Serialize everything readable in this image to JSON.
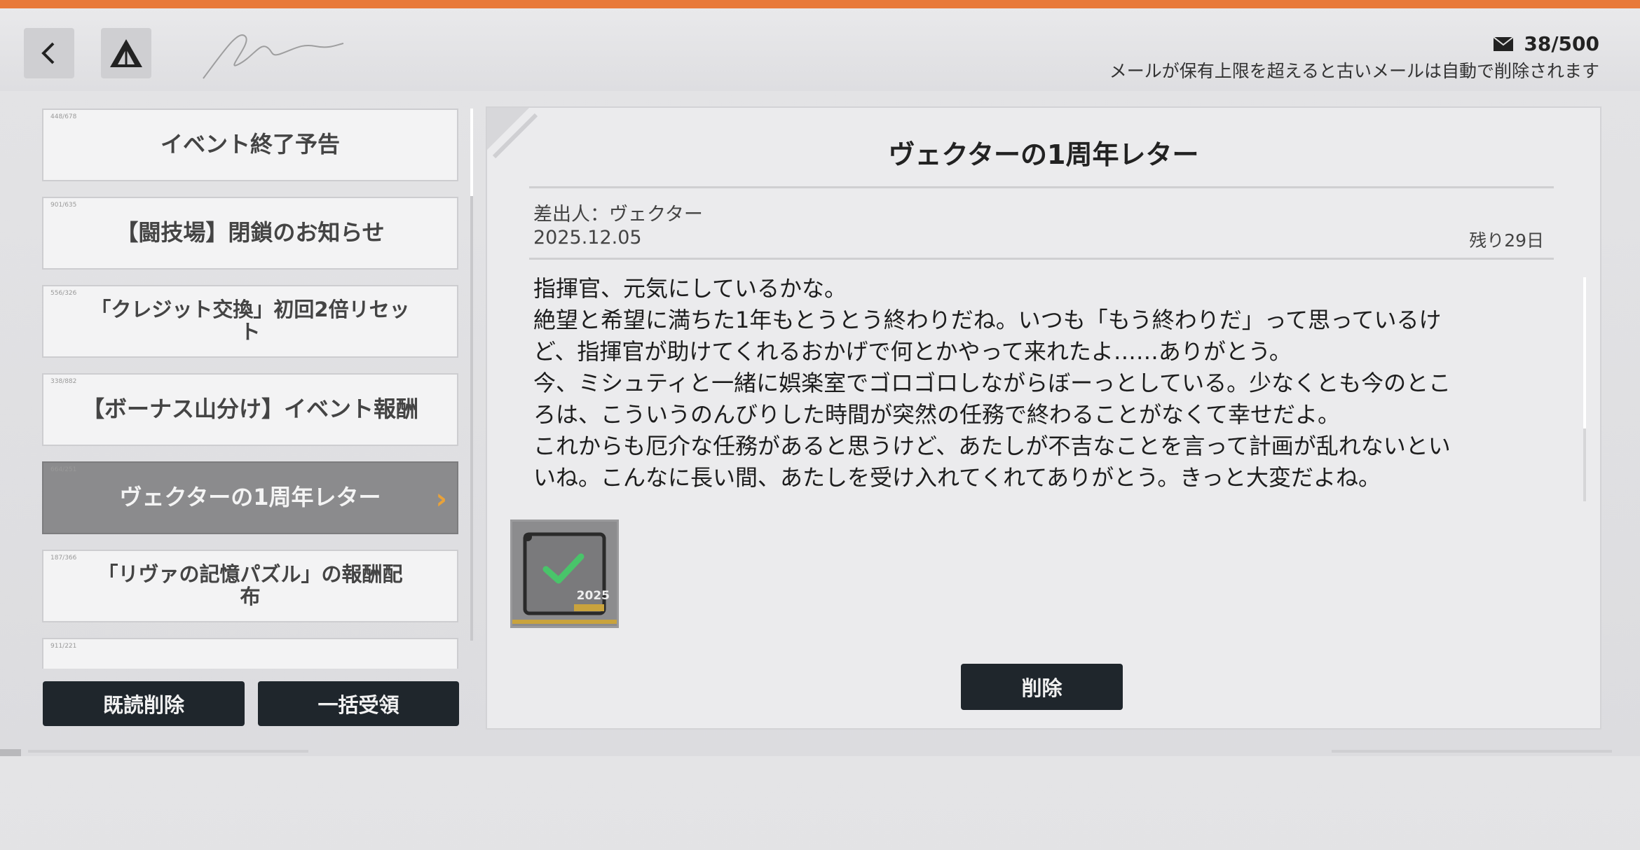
{
  "header": {
    "mail_count": "38/500",
    "mail_notice": "メールが保有上限を超えると古いメールは自動で削除されます"
  },
  "mail_list": {
    "items": [
      {
        "title": "イベント終了予告",
        "tag": "448/678"
      },
      {
        "title": "【闘技場】閉鎖のお知らせ",
        "tag": "901/635"
      },
      {
        "title_line1": "「クレジット交換」初回2倍リセッ",
        "title_line2": "ト",
        "tag": "556/326"
      },
      {
        "title": "【ボーナス山分け】イベント報酬",
        "tag": "338/882"
      },
      {
        "title": "ヴェクターの1周年レター",
        "tag": "664/251"
      },
      {
        "title_line1": "「リヴァの記憶パズル」の報酬配",
        "title_line2": "布",
        "tag": "187/366"
      },
      {
        "tag": "911/221"
      }
    ],
    "active_index": 4
  },
  "buttons": {
    "read_delete": "既読削除",
    "claim_all": "一括受領",
    "delete": "削除"
  },
  "detail": {
    "title": "ヴェクターの1周年レター",
    "sender": "差出人：ヴェクター",
    "date": "2025.12.05",
    "remaining": "残り29日",
    "body_lines": [
      "指揮官、元気にしているかな。",
      "絶望と希望に満ちた1年もとうとう終わりだね。いつも「もう終わりだ」って思っているけ",
      "ど、指揮官が助けてくれるおかげで何とかやって来れたよ……ありがとう。",
      "今、ミシュティと一緒に娯楽室でゴロゴロしながらぼーっとしている。少なくとも今のとこ",
      "ろは、こういうのんびりした時間が突然の任務で終わることがなくて幸せだよ。",
      "これからも厄介な任務があると思うけど、あたしが不吉なことを言って計画が乱れないとい",
      "いね。こんなに長い間、あたしを受け入れてくれてありがとう。きっと大変だよね。"
    ],
    "attachment": {
      "label": "2025",
      "status_icon": "check-icon",
      "claimed": true
    }
  },
  "colors": {
    "accent": "#e8793a",
    "dark_button": "#1f262c",
    "check_green": "#49c46a",
    "chevron": "#e8a23a"
  }
}
